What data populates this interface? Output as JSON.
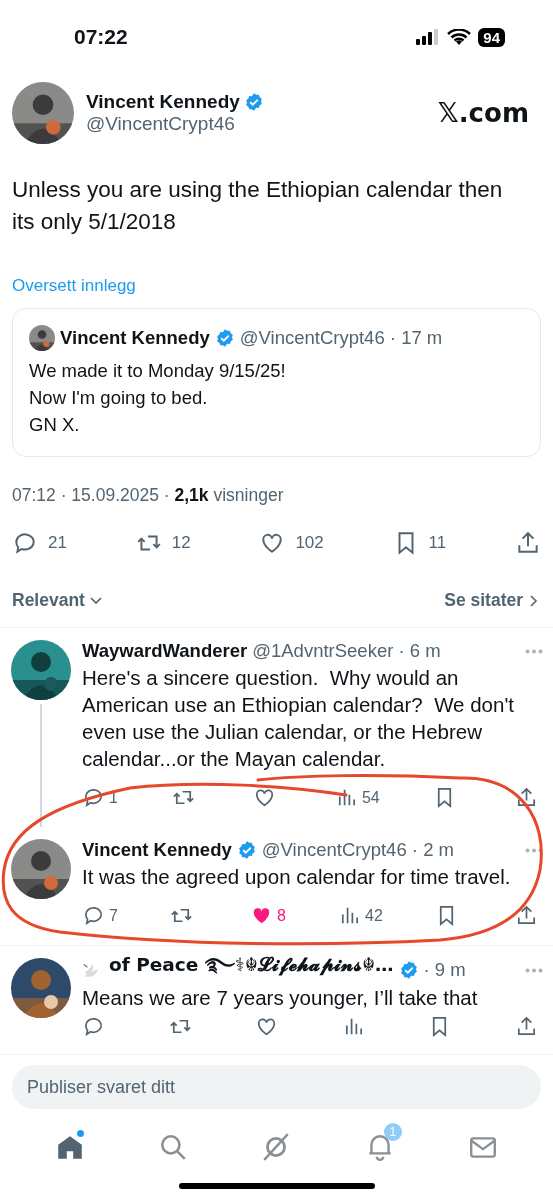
{
  "status_bar": {
    "time": "07:22",
    "battery": "94"
  },
  "post": {
    "name": "Vincent Kennedy",
    "verified": true,
    "handle": "@VincentCrypt46",
    "source": "𝕏.com",
    "text": "Unless you are using the Ethiopian calendar then its only 5/1/2018",
    "translate_link": "Oversett innlegg",
    "quote": {
      "name": "Vincent Kennedy",
      "verified": true,
      "handle_time": "@VincentCrypt46 · 17 m",
      "lines": [
        "We made it to Monday 9/15/25!",
        "Now I'm going to bed.",
        "GN X."
      ]
    },
    "meta": {
      "date_line": "07:12 · 15.09.2025 ·",
      "views_count": "2,1k",
      "views_label": "visninger"
    },
    "actions": [
      {
        "kind": "reply",
        "count": "21"
      },
      {
        "kind": "repost",
        "count": "12"
      },
      {
        "kind": "like",
        "count": "102",
        "liked": false
      },
      {
        "kind": "bookmark",
        "count": "11"
      },
      {
        "kind": "share"
      }
    ]
  },
  "sort": {
    "label": "Relevant",
    "quotes_link": "Se sitater"
  },
  "replies": [
    {
      "name": "WaywardWanderer",
      "handle_time": "@1AdvntrSeeker · 6 m",
      "text": "Here's a sincere question.  Why would an American use an Ethiopian calendar?  We don't even use the Julian calendar, or the Hebrew calendar...or the Mayan calendar.",
      "thread_line": true,
      "actions": [
        {
          "kind": "reply",
          "count": "1"
        },
        {
          "kind": "repost"
        },
        {
          "kind": "like",
          "liked": false
        },
        {
          "kind": "views",
          "count": "54"
        },
        {
          "kind": "bookmark"
        },
        {
          "kind": "share"
        }
      ]
    },
    {
      "name": "Vincent Kennedy",
      "verified": true,
      "handle_time": "@VincentCrypt46 · 2 m",
      "text": "It was the agreed upon calendar for time travel.",
      "actions": [
        {
          "kind": "reply",
          "count": "7"
        },
        {
          "kind": "repost"
        },
        {
          "kind": "like",
          "count": "8",
          "liked": true
        },
        {
          "kind": "views",
          "count": "42"
        },
        {
          "kind": "bookmark"
        },
        {
          "kind": "share"
        }
      ]
    },
    {
      "name": "of Peace ࿐⚕☬𝓛𝓲𝓯𝓮𝓱𝓪𝓹𝓲𝓷𝓼☬…",
      "dove": true,
      "verified": true,
      "handle_time": "· 9 m",
      "text": "Means we are 7 years younger, I’ll take that",
      "actions": [
        {
          "kind": "reply"
        },
        {
          "kind": "repost"
        },
        {
          "kind": "like"
        },
        {
          "kind": "views"
        },
        {
          "kind": "bookmark"
        },
        {
          "kind": "share"
        }
      ]
    }
  ],
  "reply_box": {
    "placeholder": "Publiser svaret ditt"
  },
  "tabs": [
    {
      "kind": "home",
      "selected": true,
      "dot": true
    },
    {
      "kind": "search",
      "selected": false
    },
    {
      "kind": "grok",
      "selected": false
    },
    {
      "kind": "notifications",
      "selected": false,
      "badge": "1"
    },
    {
      "kind": "messages",
      "selected": false
    }
  ]
}
